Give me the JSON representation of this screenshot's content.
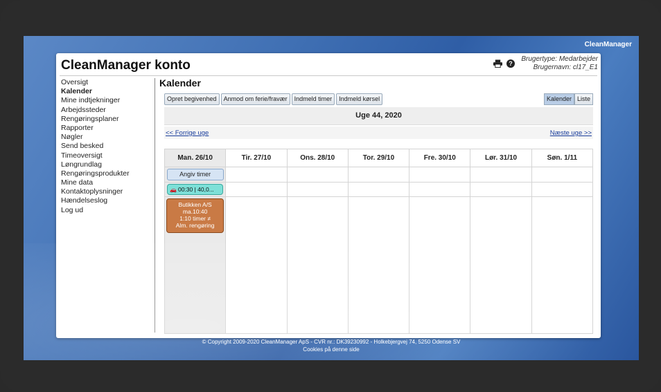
{
  "header": {
    "brand": "CleanManager",
    "title": "CleanManager konto",
    "user_type": "Brugertype: Medarbejder",
    "username": "Brugernavn: cl17_E1"
  },
  "sidebar": {
    "items": [
      {
        "label": "Oversigt"
      },
      {
        "label": "Kalender"
      },
      {
        "label": "Mine indtjekninger"
      },
      {
        "label": "Arbejdssteder"
      },
      {
        "label": "Rengøringsplaner"
      },
      {
        "label": "Rapporter"
      },
      {
        "label": "Nøgler"
      },
      {
        "label": "Send besked"
      },
      {
        "label": "Timeoversigt"
      },
      {
        "label": "Løngrundlag"
      },
      {
        "label": "Rengøringsprodukter"
      },
      {
        "label": "Mine data"
      },
      {
        "label": "Kontaktoplysninger"
      },
      {
        "label": "Hændelseslog"
      },
      {
        "label": "Log ud"
      }
    ]
  },
  "main": {
    "title": "Kalender",
    "toolbar": {
      "create_event": "Opret begivenhed",
      "request_leave": "Anmod om ferie/fravær",
      "report_hours": "Indmeld timer",
      "report_driving": "Indmeld kørsel"
    },
    "view": {
      "calendar": "Kalender",
      "list": "Liste"
    },
    "week_label": "Uge 44, 2020",
    "prev_week": "<< Forrige uge",
    "next_week": "Næste uge >>",
    "days": [
      "Man. 26/10",
      "Tir. 27/10",
      "Ons. 28/10",
      "Tor. 29/10",
      "Fre. 30/10",
      "Lør. 31/10",
      "Søn. 1/11"
    ],
    "monday": {
      "hours_button": "Angiv timer",
      "drive_entry": "00:30 | 40,0...",
      "appointment": {
        "line1": "Butikken A/S",
        "line2": "ma.10:40",
        "line3": "1:10 timer ≠",
        "line4": "Alm. rengøring"
      }
    }
  },
  "footer": {
    "copyright": "© Copyright 2009-2020 CleanManager ApS - CVR nr.: DK39230992 - Holkebjergvej 74, 5250 Odense SV",
    "cookies": "Cookies på denne side"
  },
  "colors": {
    "appointment": "#c97a45",
    "drive_entry": "#7ee0d8",
    "link": "#1a3e9c"
  }
}
